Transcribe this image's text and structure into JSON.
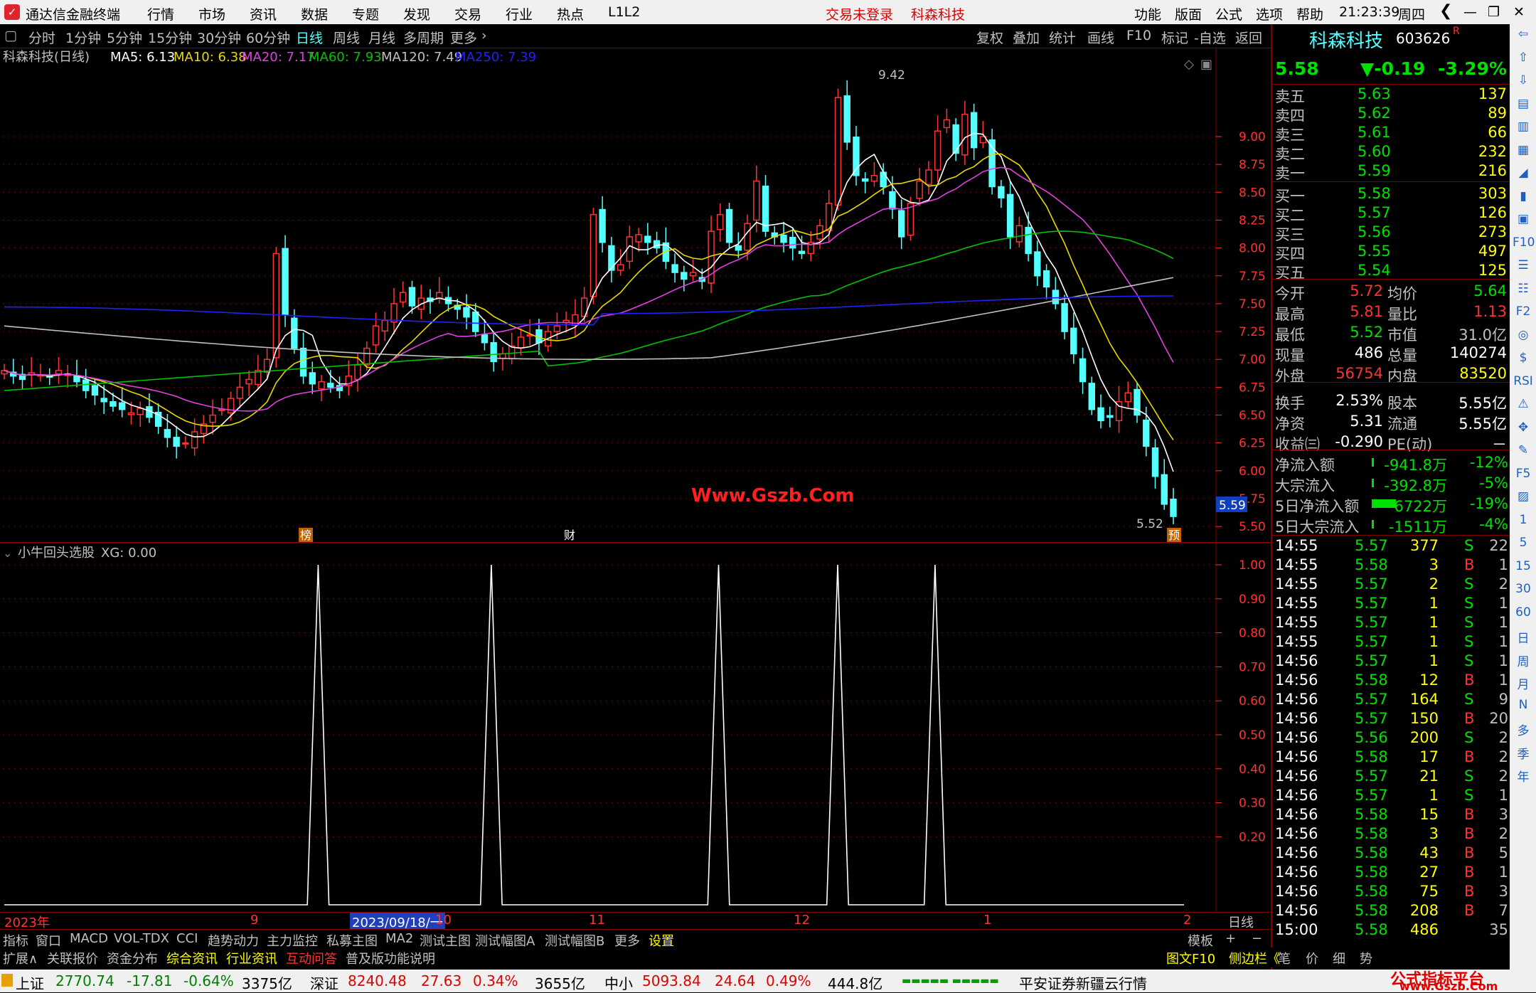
{
  "app": {
    "title": "通达信金融终端",
    "menus": [
      "行情",
      "市场",
      "资讯",
      "数据",
      "专题",
      "发现",
      "交易",
      "行业",
      "热点",
      "L1L2"
    ],
    "alert": "交易未登录",
    "stock_name_top": "科森科技",
    "right_menus": [
      "功能",
      "版面",
      "公式",
      "选项",
      "帮助"
    ],
    "time": "21:23:39",
    "weekday": "周四"
  },
  "periods": [
    "分时",
    "1分钟",
    "5分钟",
    "15分钟",
    "30分钟",
    "60分钟",
    "日线",
    "周线",
    "月线",
    "多周期",
    "更多"
  ],
  "tools": [
    "复权",
    "叠加",
    "统计",
    "画线",
    "F10",
    "标记",
    "-自选",
    "返回"
  ],
  "indicator_line": {
    "name": "科森科技(日线)",
    "ma5": "MA5: 6.13",
    "ma10": "MA10: 6.38",
    "ma20": "MA20: 7.17",
    "ma60": "MA60: 7.93",
    "ma120": "MA120: 7.49",
    "ma250": "MA250: 7.39"
  },
  "colors": {
    "up": "#ff3232",
    "down": "#54ffff",
    "ma5": "#ffffff",
    "ma10": "#e8d800",
    "ma20": "#e040e0",
    "ma60": "#00c000",
    "ma120": "#c0c0c0",
    "ma250": "#2020ff",
    "grid": "#800000"
  },
  "chart_data": [
    {
      "type": "candlestick",
      "title": "科森科技(日线)",
      "y_ticks": [
        "9.00",
        "8.75",
        "8.50",
        "8.25",
        "8.00",
        "7.75",
        "7.50",
        "7.25",
        "7.00",
        "6.75",
        "6.50",
        "6.25",
        "6.00",
        "5.75",
        "5.50"
      ],
      "ylim": [
        5.45,
        9.6
      ],
      "high_label": "9.42",
      "low_label": "5.52",
      "current_price_tag": "5.59",
      "markers": [
        "榜",
        "财",
        "预"
      ],
      "watermark": "Www.Gszb.Com",
      "closes": [
        6.9,
        6.85,
        6.82,
        6.88,
        6.86,
        6.84,
        6.9,
        6.87,
        6.8,
        6.72,
        6.68,
        6.62,
        6.58,
        6.55,
        6.52,
        6.56,
        6.48,
        6.4,
        6.3,
        6.22,
        6.25,
        6.35,
        6.42,
        6.5,
        6.55,
        6.65,
        6.75,
        6.82,
        6.9,
        7.0,
        7.95,
        7.4,
        7.1,
        6.85,
        6.78,
        6.8,
        6.75,
        6.72,
        6.85,
        6.95,
        7.1,
        7.3,
        7.35,
        7.5,
        7.6,
        7.48,
        7.55,
        7.52,
        7.6,
        7.5,
        7.45,
        7.38,
        7.25,
        7.15,
        6.98,
        7.05,
        7.12,
        7.2,
        7.22,
        7.15,
        7.25,
        7.3,
        7.35,
        7.4,
        7.55,
        8.3,
        8.05,
        7.8,
        7.85,
        8.1,
        8.12,
        8.05,
        8.0,
        7.88,
        7.78,
        7.72,
        7.78,
        7.7,
        8.15,
        8.3,
        8.05,
        7.98,
        8.22,
        8.6,
        8.15,
        8.1,
        8.05,
        8.0,
        7.95,
        8.05,
        8.2,
        8.4,
        9.35,
        8.95,
        8.65,
        8.6,
        8.65,
        8.55,
        8.35,
        8.1,
        8.4,
        8.6,
        8.7,
        9.05,
        9.15,
        8.85,
        9.2,
        8.9,
        9.0,
        8.55,
        8.45,
        8.1,
        8.2,
        7.95,
        7.75,
        7.65,
        7.5,
        7.25,
        7.05,
        6.8,
        6.55,
        6.45,
        6.48,
        6.62,
        6.7,
        6.5,
        6.22,
        5.95,
        5.7,
        5.59
      ],
      "ma_values": {
        "MA5": 6.13,
        "MA10": 6.38,
        "MA20": 7.17,
        "MA60": 7.93,
        "MA120": 7.49,
        "MA250": 7.39
      }
    },
    {
      "type": "line",
      "title": "小牛回头选股",
      "series": [
        {
          "name": "XG",
          "last_value": 0.0
        }
      ],
      "y_ticks": [
        "1.00",
        "0.90",
        "0.80",
        "0.70",
        "0.60",
        "0.50",
        "0.40",
        "0.30",
        "0.20"
      ],
      "ylim": [
        0,
        1
      ],
      "spikes_at_index": [
        29,
        45,
        66,
        77,
        86
      ],
      "count": 110
    }
  ],
  "sub_title": "小牛回头选股",
  "sub_value": "XG: 0.00",
  "x_axis": {
    "labels": [
      "2023年",
      "9",
      "2023/09/18/一",
      "10",
      "11",
      "12",
      "1",
      "2"
    ],
    "period_label": "日线"
  },
  "quote": {
    "name": "科森科技",
    "code": "603626",
    "flag": "R",
    "price": "5.58",
    "change": "▼-0.19",
    "pct": "-3.29%"
  },
  "orderbook": [
    {
      "label": "卖五",
      "price": "5.63",
      "vol": "137"
    },
    {
      "label": "卖四",
      "price": "5.62",
      "vol": "89"
    },
    {
      "label": "卖三",
      "price": "5.61",
      "vol": "66"
    },
    {
      "label": "卖二",
      "price": "5.60",
      "vol": "232"
    },
    {
      "label": "卖一",
      "price": "5.59",
      "vol": "216"
    },
    {
      "label": "买一",
      "price": "5.58",
      "vol": "303"
    },
    {
      "label": "买二",
      "price": "5.57",
      "vol": "126"
    },
    {
      "label": "买三",
      "price": "5.56",
      "vol": "273"
    },
    {
      "label": "买四",
      "price": "5.55",
      "vol": "497"
    },
    {
      "label": "买五",
      "price": "5.54",
      "vol": "125"
    }
  ],
  "stats": [
    {
      "l1": "今开",
      "v1": "5.72",
      "l2": "均价",
      "v2": "5.64"
    },
    {
      "l1": "最高",
      "v1": "5.81",
      "l2": "量比",
      "v2": "1.13"
    },
    {
      "l1": "最低",
      "v1": "5.52",
      "l2": "市值",
      "v2": "31.0亿"
    },
    {
      "l1": "现量",
      "v1": "486",
      "l2": "总量",
      "v2": "140274"
    },
    {
      "l1": "外盘",
      "v1": "56754",
      "l2": "内盘",
      "v2": "83520"
    },
    {
      "l1": "换手",
      "v1": "2.53%",
      "l2": "股本",
      "v2": "5.55亿"
    },
    {
      "l1": "净资",
      "v1": "5.31",
      "l2": "流通",
      "v2": "5.55亿"
    },
    {
      "l1": "收益㈢",
      "v1": "-0.290",
      "l2": "PE(动)",
      "v2": "－"
    }
  ],
  "flows": [
    {
      "label": "净流入额",
      "value": "-941.8万",
      "pct": "-12%"
    },
    {
      "label": "大宗流入",
      "value": "-392.8万",
      "pct": "-5%"
    },
    {
      "label": "5日净流入额",
      "value": "-6722万",
      "pct": "-19%"
    },
    {
      "label": "5日大宗流入",
      "value": "-1511万",
      "pct": "-4%"
    }
  ],
  "ticks": [
    {
      "t": "14:55",
      "p": "5.57",
      "v": "377",
      "d": "S",
      "n": "22"
    },
    {
      "t": "14:55",
      "p": "5.58",
      "v": "3",
      "d": "B",
      "n": "1"
    },
    {
      "t": "14:55",
      "p": "5.57",
      "v": "2",
      "d": "S",
      "n": "2"
    },
    {
      "t": "14:55",
      "p": "5.57",
      "v": "1",
      "d": "S",
      "n": "1"
    },
    {
      "t": "14:55",
      "p": "5.57",
      "v": "1",
      "d": "S",
      "n": "1"
    },
    {
      "t": "14:55",
      "p": "5.57",
      "v": "1",
      "d": "S",
      "n": "1"
    },
    {
      "t": "14:56",
      "p": "5.57",
      "v": "1",
      "d": "S",
      "n": "1"
    },
    {
      "t": "14:56",
      "p": "5.58",
      "v": "12",
      "d": "B",
      "n": "1"
    },
    {
      "t": "14:56",
      "p": "5.57",
      "v": "164",
      "d": "S",
      "n": "9"
    },
    {
      "t": "14:56",
      "p": "5.57",
      "v": "150",
      "d": "B",
      "n": "20"
    },
    {
      "t": "14:56",
      "p": "5.56",
      "v": "200",
      "d": "S",
      "n": "2"
    },
    {
      "t": "14:56",
      "p": "5.58",
      "v": "17",
      "d": "B",
      "n": "2"
    },
    {
      "t": "14:56",
      "p": "5.57",
      "v": "21",
      "d": "S",
      "n": "2"
    },
    {
      "t": "14:56",
      "p": "5.57",
      "v": "1",
      "d": "S",
      "n": "1"
    },
    {
      "t": "14:56",
      "p": "5.58",
      "v": "15",
      "d": "B",
      "n": "3"
    },
    {
      "t": "14:56",
      "p": "5.58",
      "v": "3",
      "d": "B",
      "n": "2"
    },
    {
      "t": "14:56",
      "p": "5.58",
      "v": "43",
      "d": "B",
      "n": "5"
    },
    {
      "t": "14:56",
      "p": "5.58",
      "v": "27",
      "d": "B",
      "n": "1"
    },
    {
      "t": "14:56",
      "p": "5.58",
      "v": "75",
      "d": "B",
      "n": "3"
    },
    {
      "t": "14:56",
      "p": "5.58",
      "v": "208",
      "d": "B",
      "n": "7"
    },
    {
      "t": "15:00",
      "p": "5.58",
      "v": "486",
      "d": "",
      "n": "35"
    }
  ],
  "tabs1": [
    "指标",
    "窗口",
    "MACD",
    "VOL-TDX",
    "CCI",
    "趋势动力",
    "主力监控",
    "私募主图",
    "MA2",
    "测试主图",
    "测试幅图A",
    "测试幅图B",
    "更多",
    "设置"
  ],
  "tabs1_right": [
    "模板",
    "+",
    "−"
  ],
  "tabs2": [
    "扩展∧",
    "关联报价",
    "资金分布",
    "综合资讯",
    "行业资讯",
    "互动问答",
    "普及版功能说明"
  ],
  "tabs2_right": [
    "图文F10",
    "侧边栏《",
    "笔",
    "价",
    "细",
    "势"
  ],
  "side_icons": [
    "⇦",
    "⇧",
    "⇩",
    "▤",
    "▥",
    "▦",
    "◢",
    "▮",
    "▣",
    "F10",
    "☰",
    "☷",
    "F2",
    "◎",
    "$",
    "RSI",
    "⚠",
    "✥",
    "✎",
    "F5",
    "▨",
    "1",
    "5",
    "15",
    "30",
    "60",
    "日",
    "周",
    "月",
    "N",
    "多",
    "季",
    "年"
  ],
  "status": {
    "sh_label": "上证",
    "sh_val": "2770.74",
    "sh_chg": "-17.81",
    "sh_pct": "-0.64%",
    "sh_amt": "3375亿",
    "sz_label": "深证",
    "sz_val": "8240.48",
    "sz_chg": "27.63",
    "sz_pct": "0.34%",
    "sz_amt": "3655亿",
    "zx_label": "中小",
    "zx_val": "5093.84",
    "zx_chg": "24.64",
    "zx_pct": "0.49%",
    "zx_amt": "444.8亿",
    "broker": "平安证券新疆云行情",
    "brand": "公式指标平台",
    "brand_url": "www.Gszb.Com"
  }
}
